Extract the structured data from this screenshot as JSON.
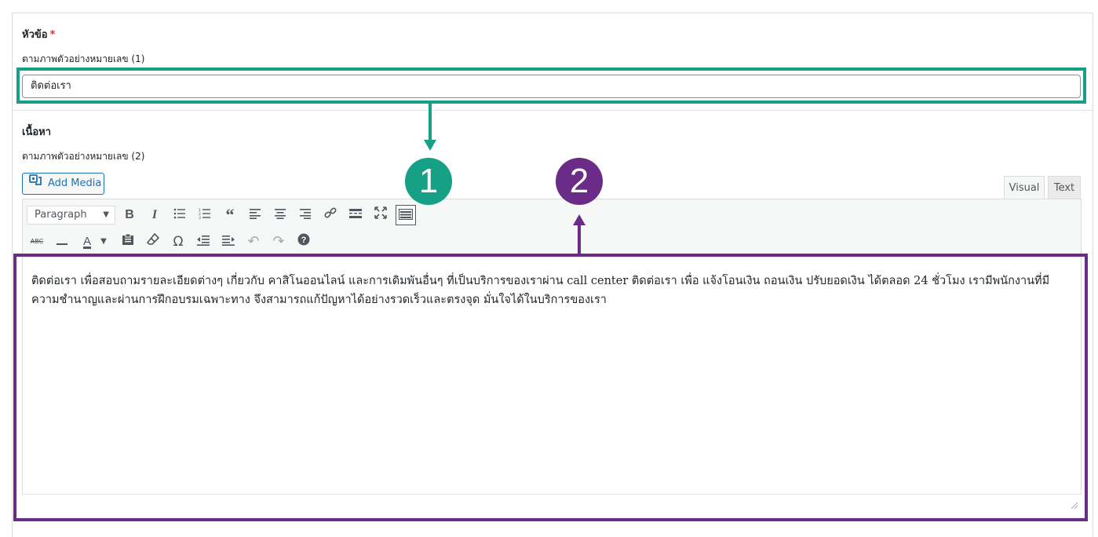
{
  "title_field": {
    "label": "หัวข้อ",
    "required_mark": "*",
    "hint": "ตามภาพตัวอย่างหมายเลข (1)",
    "value": "ติดต่อเรา"
  },
  "content_field": {
    "label": "เนื้อหา",
    "hint": "ตามภาพตัวอย่างหมายเลข (2)"
  },
  "editor": {
    "add_media_label": "Add Media",
    "tabs": {
      "visual": "Visual",
      "text": "Text",
      "active": "Visual"
    },
    "format_select": "Paragraph",
    "toolbar_row1": [
      "bold-icon",
      "italic-icon",
      "bullet-list-icon",
      "numbered-list-icon",
      "blockquote-icon",
      "align-left-icon",
      "align-center-icon",
      "align-right-icon",
      "link-icon",
      "read-more-icon",
      "fullscreen-icon",
      "toolbar-toggle-icon"
    ],
    "toolbar_row2": [
      "strikethrough-icon",
      "horizontal-line-icon",
      "text-color-icon",
      "paste-text-icon",
      "clear-formatting-icon",
      "special-character-icon",
      "outdent-icon",
      "indent-icon",
      "undo-icon",
      "redo-icon",
      "help-icon"
    ],
    "body_text": "ติดต่อเรา เพื่อสอบถามรายละเอียดต่างๆ เกี่ยวกับ คาสิโนออนไลน์ และการเดิมพันอื่นๆ ที่เป็นบริการของเราผ่าน call center ติดต่อเรา เพื่อ แจ้งโอนเงิน ถอนเงิน ปรับยอดเงิน ได้ตลอด 24 ชั่วโมง เรามีพนักงานที่มีความชำนาญและผ่านการฝึกอบรมเฉพาะทาง จึงสามารถแก้ปัญหาได้อย่างรวดเร็วและตรงจุด มั่นใจได้ในบริการของเรา"
  },
  "annotations": {
    "badge_1": "1",
    "badge_2": "2",
    "color_1": "#16a085",
    "color_2": "#6a2c87"
  }
}
